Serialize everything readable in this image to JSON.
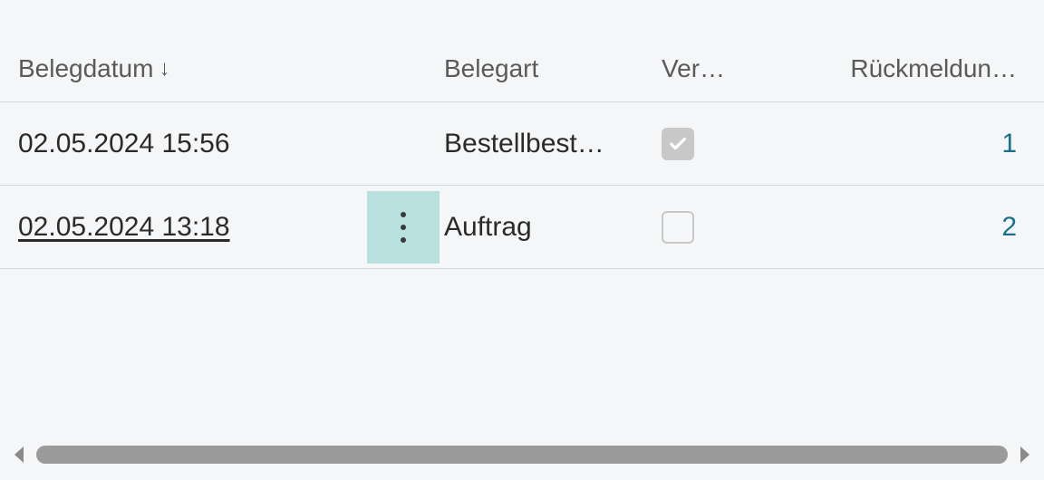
{
  "columns": {
    "belegdatum": "Belegdatum",
    "belegart": "Belegart",
    "ver": "Ver…",
    "rueckmeldung": "Rückmeldun…"
  },
  "sort": {
    "column": "belegdatum",
    "direction_icon": "↓"
  },
  "rows": [
    {
      "date": "02.05.2024 15:56",
      "date_underlined": false,
      "show_kebab": false,
      "belegart": "Bestellbest…",
      "ver_checked": true,
      "rueck": "1"
    },
    {
      "date": "02.05.2024 13:18",
      "date_underlined": true,
      "show_kebab": true,
      "belegart": "Auftrag",
      "ver_checked": false,
      "rueck": "2"
    }
  ]
}
